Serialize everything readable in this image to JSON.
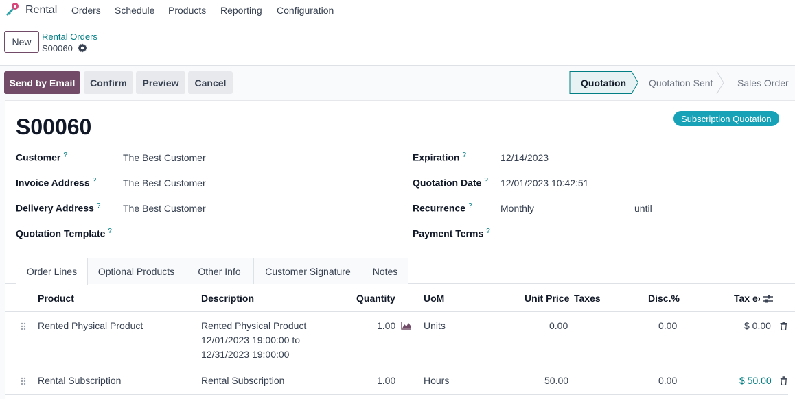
{
  "nav": {
    "app_name": "Rental",
    "menu": [
      "Orders",
      "Schedule",
      "Products",
      "Reporting",
      "Configuration"
    ]
  },
  "control": {
    "new_label": "New",
    "breadcrumb_parent": "Rental Orders",
    "breadcrumb_current": "S00060"
  },
  "actions": {
    "send_by_email": "Send by Email",
    "confirm": "Confirm",
    "preview": "Preview",
    "cancel": "Cancel"
  },
  "statusbar": {
    "steps": [
      "Quotation",
      "Quotation Sent",
      "Sales Order"
    ],
    "active": "Quotation"
  },
  "record": {
    "title": "S00060",
    "badge": "Subscription Quotation"
  },
  "fields": {
    "customer_label": "Customer",
    "customer_value": "The Best Customer",
    "invoice_label": "Invoice Address",
    "invoice_value": "The Best Customer",
    "delivery_label": "Delivery Address",
    "delivery_value": "The Best Customer",
    "template_label": "Quotation Template",
    "expiration_label": "Expiration",
    "expiration_value": "12/14/2023",
    "quotation_date_label": "Quotation Date",
    "quotation_date_value": "12/01/2023 10:42:51",
    "recurrence_label": "Recurrence",
    "recurrence_value": "Monthly",
    "recurrence_until": "until",
    "payment_terms_label": "Payment Terms",
    "help_mark": "?"
  },
  "tabs": [
    "Order Lines",
    "Optional Products",
    "Other Info",
    "Customer Signature",
    "Notes"
  ],
  "table": {
    "headers": {
      "product": "Product",
      "description": "Description",
      "quantity": "Quantity",
      "uom": "UoM",
      "unit_price": "Unit Price",
      "taxes": "Taxes",
      "disc": "Disc.%",
      "tax_excl": "Tax e›"
    },
    "rows": [
      {
        "product": "Rented Physical Product",
        "description": [
          "Rented Physical Product",
          "12/01/2023 19:00:00 to",
          "12/31/2023 19:00:00"
        ],
        "quantity": "1.00",
        "uom": "Units",
        "unit_price": "0.00",
        "disc": "0.00",
        "subtotal": "$ 0.00"
      },
      {
        "product": "Rental Subscription",
        "description": [
          "Rental Subscription"
        ],
        "quantity": "1.00",
        "uom": "Hours",
        "unit_price": "50.00",
        "disc": "0.00",
        "subtotal": "$ 50.00"
      }
    ]
  },
  "colors": {
    "brand": "#714b67",
    "accent": "#017e84",
    "badge": "#17a2b8"
  }
}
